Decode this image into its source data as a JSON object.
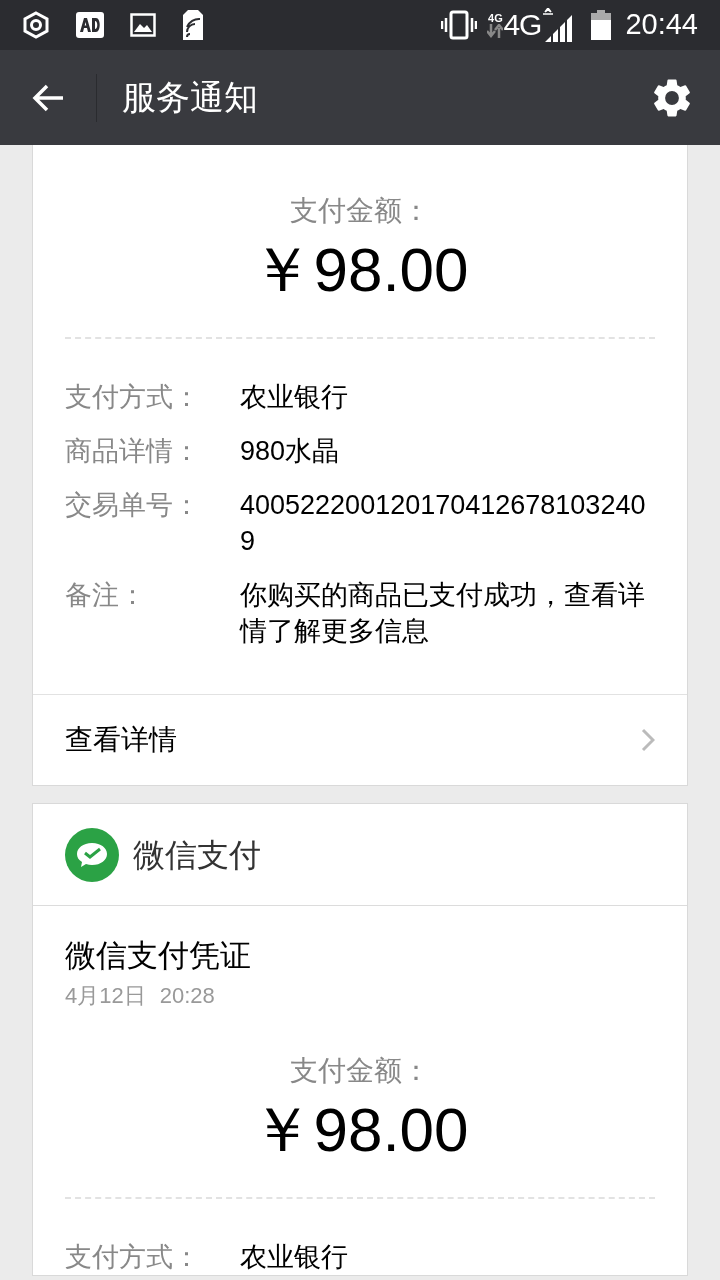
{
  "status_bar": {
    "network_small": "4G",
    "network": "4G",
    "time": "20:44"
  },
  "header": {
    "title": "服务通知"
  },
  "cards": [
    {
      "kind": "receipt_tail",
      "amount_label": "支付金额：",
      "amount": "￥98.00",
      "details": [
        {
          "label": "支付方式：",
          "value": "农业银行"
        },
        {
          "label": "商品详情：",
          "value": "980水晶"
        },
        {
          "label": "交易单号：",
          "value": "4005222001201704126781032409"
        },
        {
          "label": "备注：",
          "value": "你购买的商品已支付成功，查看详情了解更多信息"
        }
      ],
      "link": "查看详情"
    },
    {
      "kind": "receipt",
      "app_name": "微信支付",
      "title": "微信支付凭证",
      "date": "4月12日",
      "time": "20:28",
      "amount_label": "支付金额：",
      "amount": "￥98.00",
      "details": [
        {
          "label": "支付方式：",
          "value": "农业银行"
        }
      ]
    }
  ]
}
